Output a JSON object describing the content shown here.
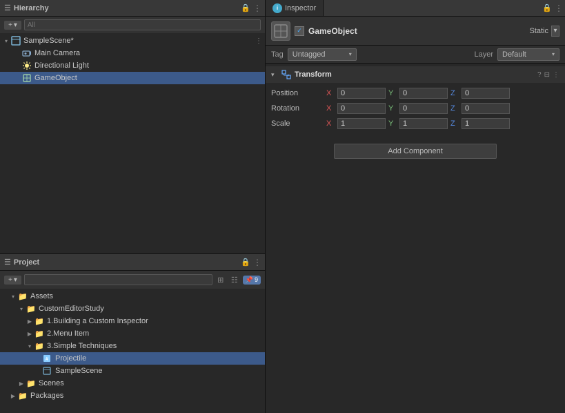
{
  "hierarchy": {
    "title": "Hierarchy",
    "search_placeholder": "All",
    "items": [
      {
        "id": "samplescene",
        "label": "SampleScene*",
        "type": "scene",
        "level": 0,
        "expanded": true
      },
      {
        "id": "maincamera",
        "label": "Main Camera",
        "type": "camera",
        "level": 1
      },
      {
        "id": "directionallight",
        "label": "Directional Light",
        "type": "light",
        "level": 1
      },
      {
        "id": "gameobject",
        "label": "GameObject",
        "type": "gameobject",
        "level": 1
      }
    ]
  },
  "inspector": {
    "tab_label": "Inspector",
    "gameobject_name": "GameObject",
    "static_label": "Static",
    "tag_label": "Tag",
    "tag_value": "Untagged",
    "layer_label": "Layer",
    "layer_value": "Default",
    "transform": {
      "title": "Transform",
      "position": {
        "label": "Position",
        "x": "0",
        "y": "0",
        "z": "0"
      },
      "rotation": {
        "label": "Rotation",
        "x": "0",
        "y": "0",
        "z": "0"
      },
      "scale": {
        "label": "Scale",
        "x": "1",
        "y": "1",
        "z": "1"
      }
    },
    "add_component_label": "Add Component"
  },
  "project": {
    "title": "Project",
    "badge_count": "9",
    "items": [
      {
        "id": "assets",
        "label": "Assets",
        "type": "folder",
        "indent": 0,
        "expanded": true
      },
      {
        "id": "customeditorstudy",
        "label": "CustomEditorStudy",
        "type": "folder",
        "indent": 1,
        "expanded": true
      },
      {
        "id": "building",
        "label": "1.Building a Custom Inspector",
        "type": "folder",
        "indent": 2,
        "expanded": false
      },
      {
        "id": "menu",
        "label": "2.Menu Item",
        "type": "folder",
        "indent": 2,
        "expanded": false
      },
      {
        "id": "simple",
        "label": "3.Simple Techniques",
        "type": "folder",
        "indent": 2,
        "expanded": true
      },
      {
        "id": "projectile",
        "label": "Projectile",
        "type": "file",
        "indent": 3
      },
      {
        "id": "samplescene",
        "label": "SampleScene",
        "type": "scene",
        "indent": 3
      },
      {
        "id": "scenes",
        "label": "Scenes",
        "type": "folder",
        "indent": 1,
        "expanded": false
      },
      {
        "id": "packages",
        "label": "Packages",
        "type": "folder",
        "indent": 0,
        "expanded": false
      }
    ]
  }
}
